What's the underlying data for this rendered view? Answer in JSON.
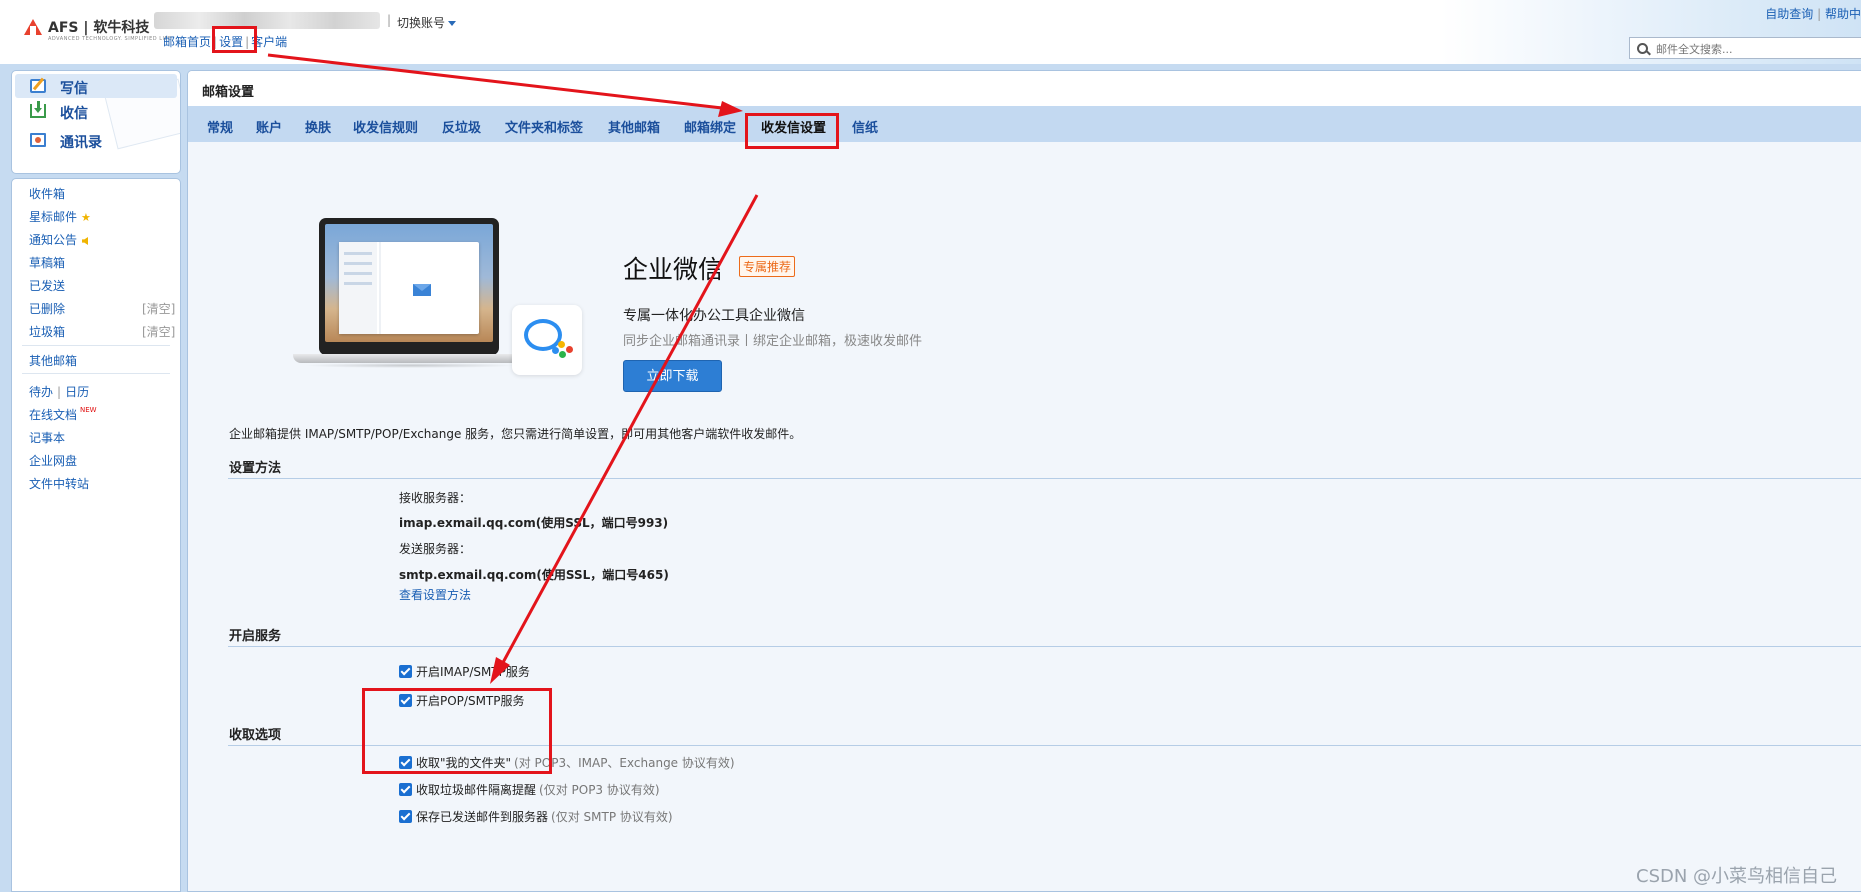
{
  "header": {
    "logo_text": "AFS | 软牛科技",
    "logo_sub": "ADVANCED TECHNOLOGY. SIMPLIFIED LIFE",
    "switch_account": "切换账号",
    "links": [
      "邮箱首页",
      "设置",
      "客户端"
    ],
    "help_links": [
      "自助查询",
      "帮助中"
    ],
    "search_placeholder": "邮件全文搜索..."
  },
  "sidebar": {
    "quick": [
      {
        "label": "写信",
        "icon": "compose-icon"
      },
      {
        "label": "收信",
        "icon": "inbox-download-icon"
      },
      {
        "label": "通讯录",
        "icon": "contacts-icon"
      }
    ],
    "folders": [
      "收件箱",
      "星标邮件",
      "通知公告",
      "草稿箱",
      "已发送",
      "已删除",
      "垃圾箱"
    ],
    "clear_label": "[清空]",
    "other_mailbox": "其他邮箱",
    "todo": "待办",
    "calendar": "日历",
    "tools": [
      "在线文档",
      "记事本",
      "企业网盘",
      "文件中转站"
    ],
    "new_badge": "NEW"
  },
  "main": {
    "title": "邮箱设置",
    "tabs": [
      "常规",
      "账户",
      "换肤",
      "收发信规则",
      "反垃圾",
      "文件夹和标签",
      "其他邮箱",
      "邮箱绑定",
      "收发信设置",
      "信纸"
    ],
    "active_tab": "收发信设置"
  },
  "promo": {
    "title": "企业微信",
    "badge": "专属推荐",
    "subtitle": "专属一体化办公工具企业微信",
    "desc": "同步企业邮箱通讯录丨绑定企业邮箱，极速收发邮件",
    "button": "立即下载"
  },
  "content": {
    "intro": "企业邮箱提供 IMAP/SMTP/POP/Exchange 服务，您只需进行简单设置，即可用其他客户端软件收发邮件。",
    "setup_title": "设置方法",
    "recv_label": "接收服务器：",
    "recv_value": "imap.exmail.qq.com(使用SSL，端口号993)",
    "send_label": "发送服务器：",
    "send_value": "smtp.exmail.qq.com(使用SSL，端口号465)",
    "how_link": "查看设置方法",
    "services_title": "开启服务",
    "services": [
      {
        "label": "开启IMAP/SMTP服务",
        "checked": true
      },
      {
        "label": "开启POP/SMTP服务",
        "checked": true
      }
    ],
    "options_title": "收取选项",
    "options": [
      {
        "label": "收取\"我的文件夹\"",
        "note": "(对 POP3、IMAP、Exchange 协议有效)",
        "checked": true
      },
      {
        "label": "收取垃圾邮件隔离提醒",
        "note": "(仅对 POP3 协议有效)",
        "checked": true
      },
      {
        "label": "保存已发送邮件到服务器",
        "note": "(仅对 SMTP 协议有效)",
        "checked": true
      }
    ]
  },
  "watermark": "CSDN @小菜鸟相信自己",
  "colors": {
    "annotation_red": "#e3141b",
    "tab_bar": "#c3d9f1",
    "frame": "#c6dbf1",
    "link_blue": "#1a5fb4",
    "button_blue": "#2d7ed4"
  }
}
